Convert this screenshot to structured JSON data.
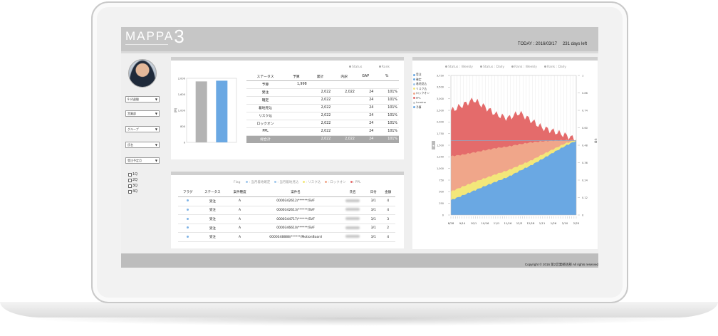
{
  "app": {
    "logo_text": "MAPPA",
    "logo_number": "3"
  },
  "header": {
    "today_label": "TODAY : 2016/03/17",
    "days_left": "231 days left"
  },
  "footer": {
    "copyright": "Copyright &copy; 2016 第2営業統括部  All rights reserved"
  },
  "sidebar": {
    "selects": [
      "9 /4週間",
      "営業部",
      "グループ",
      "氏名",
      "受注予定月"
    ],
    "checkboxes": [
      "1Q",
      "2Q",
      "3Q",
      "4Q"
    ]
  },
  "summary": {
    "legend": [
      "Status",
      "Rank"
    ],
    "headers": [
      "ステータス",
      "予算",
      "累計",
      "内訳",
      "GAP",
      "%"
    ],
    "rows": [
      [
        "予算",
        "1,998",
        "",
        "",
        "",
        ""
      ],
      [
        "受注",
        "",
        "2,022",
        "2,022",
        "24",
        "101%"
      ],
      [
        "確定",
        "",
        "2,022",
        "",
        "24",
        "101%"
      ],
      [
        "着地見込",
        "",
        "2,022",
        "",
        "24",
        "101%"
      ],
      [
        "リスク込",
        "",
        "2,022",
        "",
        "24",
        "101%"
      ],
      [
        "ロックオン",
        "",
        "2,022",
        "",
        "24",
        "101%"
      ],
      [
        "PPL",
        "",
        "2,022",
        "",
        "24",
        "101%"
      ]
    ],
    "total": [
      "総合計",
      "",
      "2,022",
      "2,022",
      "24",
      "101%"
    ]
  },
  "bar_chart": {
    "chart_data": {
      "type": "bar",
      "categories": [
        "予算",
        "累計"
      ],
      "values": [
        1998,
        2022
      ],
      "colors": [
        "#b3b3b3",
        "#6aa8e3"
      ],
      "ylabel": "(M)",
      "yticks": [
        "2,000",
        "1,600",
        "1,000",
        "800",
        "0"
      ],
      "ylim": [
        0,
        2100
      ]
    }
  },
  "cases": {
    "legend_title": "Flag",
    "legend": [
      {
        "label": "当月着地確定",
        "color": "#9fc7ec"
      },
      {
        "label": "当月着地見込",
        "color": "#9fc7ec"
      },
      {
        "label": "リスク込",
        "color": "#f3e77a"
      },
      {
        "label": "ロックオン",
        "color": "#f0a68a"
      },
      {
        "label": "PPL",
        "color": "#e46b6b"
      }
    ],
    "headers": [
      "フラグ",
      "ステータス",
      "案件種度",
      "案件名",
      "氏名",
      "日付",
      "金額"
    ],
    "rows": [
      [
        "受注",
        "A",
        "0000342612/******/SVF",
        "3/1",
        "4"
      ],
      [
        "受注",
        "A",
        "0000342613/******/SVF",
        "3/1",
        "4"
      ],
      [
        "受注",
        "A",
        "0000344717/******/SVF",
        "3/1",
        "3"
      ],
      [
        "受注",
        "A",
        "0000346610/******/SVF",
        "3/1",
        "2"
      ],
      [
        "受注",
        "A",
        "0000348888/******/MotionBoard",
        "3/1",
        "4"
      ]
    ]
  },
  "area_chart": {
    "tabs": [
      "Status : Weekly",
      "Status : Daily",
      "Rank : Weekly",
      "Rank : Daily"
    ],
    "legend": [
      {
        "label": "受注",
        "color": "#6aa8e3"
      },
      {
        "label": "確定",
        "color": "#6aa8e3"
      },
      {
        "label": "着地見込",
        "color": "#9fc7ec"
      },
      {
        "label": "リスク込",
        "color": "#f3e77a"
      },
      {
        "label": "ロックオン",
        "color": "#f0a68a"
      },
      {
        "label": "PPL",
        "color": "#e46b6b"
      },
      {
        "label": "Lumine",
        "color": "#cccccc"
      },
      {
        "label": "予算",
        "color": "#6aa8e3"
      }
    ],
    "chart_data": {
      "type": "area",
      "x": [
        "8/28",
        "9/14",
        "10/1",
        "10/16",
        "11/1",
        "11/16",
        "12/3",
        "12/18",
        "1/11",
        "1/26",
        "2/10",
        "2/25"
      ],
      "yticks_left": [
        "3,750",
        "3,500",
        "3,000",
        "2,500",
        "2,000",
        "1,750",
        "1,500",
        "1,250",
        "1,000",
        "750",
        "500",
        "250",
        "0"
      ],
      "yticks_right": [
        "1",
        "0.86",
        "0.74",
        "0.60",
        "0.48",
        "0.36",
        "0.24",
        "0.12",
        "0"
      ],
      "ylabel_right": "予算",
      "ylim": [
        0,
        3750
      ],
      "budget_line": 2000,
      "series": [
        {
          "name": "受注",
          "color": "#6aa8e3",
          "values": [
            400,
            520,
            650,
            780,
            900,
            1020,
            1180,
            1330,
            1500,
            1680,
            1850,
            2000
          ]
        },
        {
          "name": "リスク込",
          "color": "#f3e77a",
          "values": [
            630,
            760,
            880,
            990,
            1100,
            1200,
            1330,
            1460,
            1620,
            1770,
            1920,
            2020
          ]
        },
        {
          "name": "ロックオン",
          "color": "#f0a68a",
          "values": [
            1580,
            1620,
            1680,
            1740,
            1800,
            1840,
            1900,
            1950,
            1980,
            2000,
            2010,
            2020
          ]
        },
        {
          "name": "PPL",
          "color": "#e46b6b",
          "values": [
            2800,
            2950,
            3100,
            2900,
            2700,
            2600,
            2750,
            2550,
            2350,
            2250,
            2150,
            2030
          ]
        }
      ]
    }
  }
}
